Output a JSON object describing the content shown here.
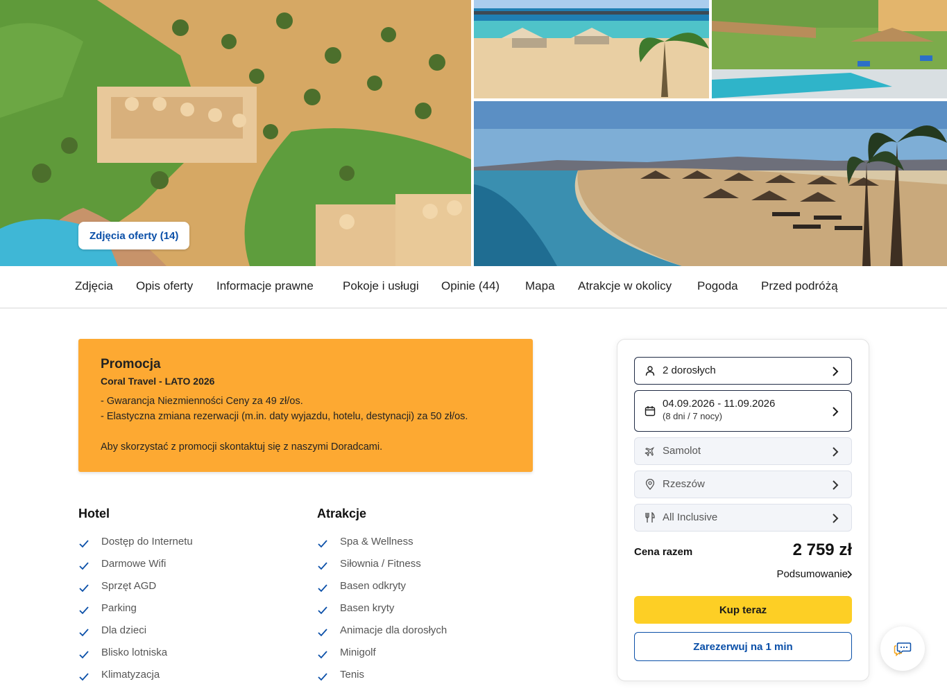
{
  "gallery": {
    "photos_button_label": "Zdjęcia oferty (14)"
  },
  "tabs": [
    {
      "label": "Zdjęcia"
    },
    {
      "label": "Opis oferty"
    },
    {
      "label": "Informacje prawne"
    },
    {
      "label": "Pokoje i usługi"
    },
    {
      "label": "Opinie (44)"
    },
    {
      "label": "Mapa"
    },
    {
      "label": "Atrakcje w okolicy"
    },
    {
      "label": "Pogoda"
    },
    {
      "label": "Przed podróżą"
    }
  ],
  "promo": {
    "title": "Promocja",
    "subtitle": "Coral Travel - LATO 2026",
    "lines": [
      "- Gwarancja Niezmienności Ceny za 49 zł/os.",
      "- Elastyczna zmiana rezerwacji (m.in. daty wyjazdu, hotelu, destynacji) za 50 zł/os.",
      "Aby skorzystać z promocji skontaktuj się z naszymi Doradcami."
    ]
  },
  "hotel": {
    "title": "Hotel",
    "items": [
      "Dostęp do Internetu",
      "Darmowe Wifi",
      "Sprzęt AGD",
      "Parking",
      "Dla dzieci",
      "Blisko lotniska",
      "Klimatyzacja"
    ]
  },
  "attractions": {
    "title": "Atrakcje",
    "items": [
      "Spa & Wellness",
      "Siłownia / Fitness",
      "Basen odkryty",
      "Basen kryty",
      "Animacje dla dorosłych",
      "Minigolf",
      "Tenis"
    ]
  },
  "booking": {
    "travelers": "2 dorosłych",
    "dates": "04.09.2026 - 11.09.2026",
    "duration": "(8 dni / 7 nocy)",
    "transport": "Samolot",
    "departure": "Rzeszów",
    "board": "All Inclusive",
    "price_label": "Cena razem",
    "price_value": "2 759 zł",
    "summary_label": "Podsumowanie",
    "buy_label": "Kup teraz",
    "reserve_label": "Zarezerwuj na 1 min"
  },
  "colors": {
    "accent_blue": "#0a4fa8",
    "promo_orange": "#fda932",
    "buy_yellow": "#fdcf25"
  },
  "icons": [
    "user-icon",
    "calendar-icon",
    "plane-icon",
    "location-pin-icon",
    "cutlery-icon",
    "chevron-right-icon",
    "check-icon",
    "chat-icon"
  ]
}
